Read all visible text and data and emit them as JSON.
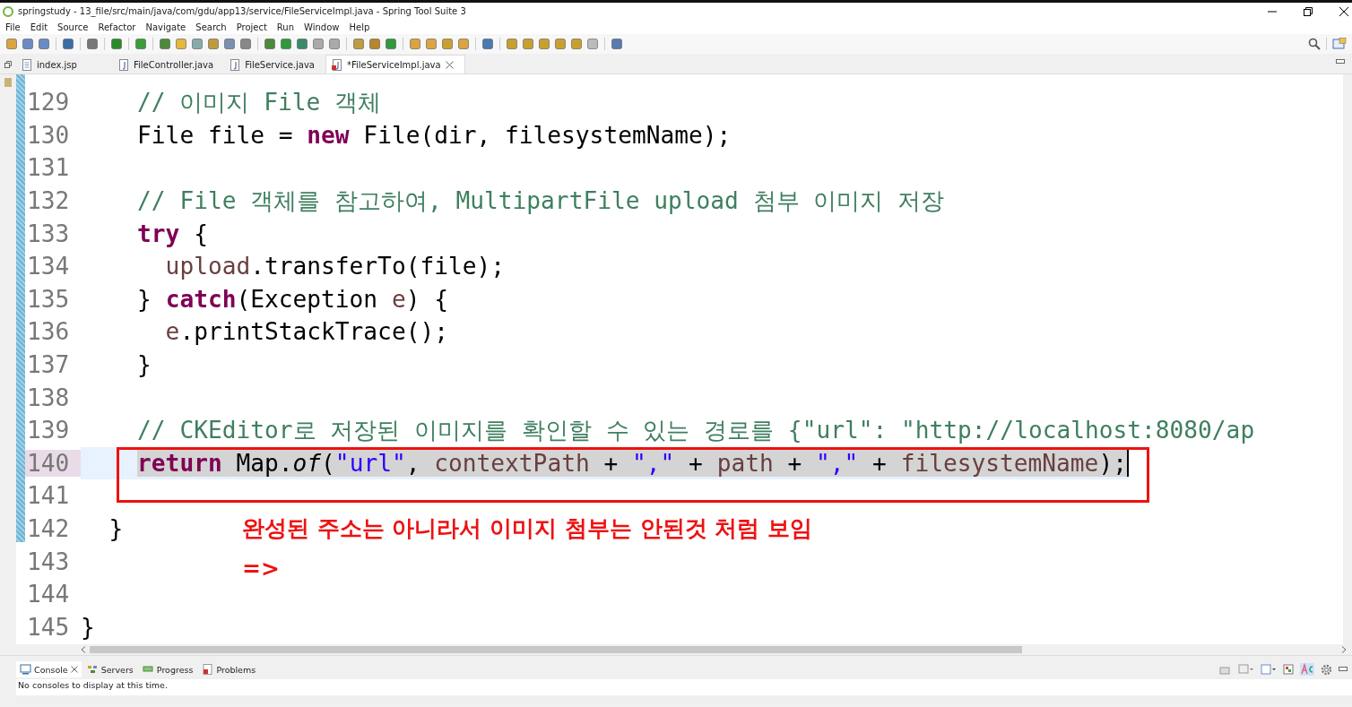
{
  "window": {
    "title": "springstudy - 13_file/src/main/java/com/gdu/app13/service/FileServiceImpl.java - Spring Tool Suite 3"
  },
  "menu": [
    "File",
    "Edit",
    "Source",
    "Refactor",
    "Navigate",
    "Search",
    "Project",
    "Run",
    "Window",
    "Help"
  ],
  "tabs": [
    {
      "label": "index.jsp",
      "selected": false,
      "kind": "jsp"
    },
    {
      "label": "FileController.java",
      "selected": false,
      "kind": "java"
    },
    {
      "label": "FileService.java",
      "selected": false,
      "kind": "java"
    },
    {
      "label": "*FileServiceImpl.java",
      "selected": true,
      "kind": "java"
    }
  ],
  "editor": {
    "lines": [
      {
        "number": "129",
        "current": false,
        "tokens": [
          {
            "text": "    // 이미지 File 객체",
            "kind": "comment"
          }
        ]
      },
      {
        "number": "130",
        "current": false,
        "tokens": [
          {
            "text": "    File file = ",
            "kind": "plain"
          },
          {
            "text": "new",
            "kind": "keyword"
          },
          {
            "text": " File(dir, filesystemName);",
            "kind": "plain"
          }
        ]
      },
      {
        "number": "131",
        "current": false
      },
      {
        "number": "132",
        "current": false,
        "tokens": [
          {
            "text": "    // File 객체를 참고하여, MultipartFile upload 첨부 이미지 저장",
            "kind": "comment"
          }
        ]
      },
      {
        "number": "133",
        "current": false,
        "tokens": [
          {
            "text": "    try",
            "kind": "keyword"
          },
          {
            "text": " {",
            "kind": "plain"
          }
        ]
      },
      {
        "number": "134",
        "current": false,
        "tokens": [
          {
            "text": "      upload",
            "kind": "local"
          },
          {
            "text": ".transferTo(file);",
            "kind": "plain"
          }
        ]
      },
      {
        "number": "135",
        "current": false,
        "tokens": [
          {
            "text": "    } ",
            "kind": "plain"
          },
          {
            "text": "catch",
            "kind": "keyword"
          },
          {
            "text": "(Exception ",
            "kind": "plain"
          },
          {
            "text": "e",
            "kind": "local"
          },
          {
            "text": ") {",
            "kind": "plain"
          }
        ]
      },
      {
        "number": "136",
        "current": false,
        "tokens": [
          {
            "text": "      e",
            "kind": "local"
          },
          {
            "text": ".printStackTrace();",
            "kind": "plain"
          }
        ]
      },
      {
        "number": "137",
        "current": false,
        "tokens": [
          {
            "text": "    }",
            "kind": "plain"
          }
        ]
      },
      {
        "number": "138",
        "current": false
      },
      {
        "number": "139",
        "current": false,
        "tokens": [
          {
            "text": "    // CKEditor로 저장된 이미지를 확인할 수 있는 경로를 {\"url\": \"http://localhost:8080/ap",
            "kind": "comment"
          }
        ]
      },
      {
        "number": "140",
        "current": true,
        "tokens": [
          {
            "text": "    return",
            "kind": "keyword"
          },
          {
            "text": " Map.",
            "kind": "plain"
          },
          {
            "text": "of",
            "kind": "static"
          },
          {
            "text": "(",
            "kind": "plain"
          },
          {
            "text": "\"url\"",
            "kind": "string"
          },
          {
            "text": ", ",
            "kind": "plain"
          },
          {
            "text": "contextPath",
            "kind": "local"
          },
          {
            "text": " + ",
            "kind": "plain"
          },
          {
            "text": "\",\"",
            "kind": "string"
          },
          {
            "text": " + ",
            "kind": "plain"
          },
          {
            "text": "path",
            "kind": "local"
          },
          {
            "text": " + ",
            "kind": "plain"
          },
          {
            "text": "\",\"",
            "kind": "string"
          },
          {
            "text": " + ",
            "kind": "plain"
          },
          {
            "text": "filesystemName",
            "kind": "local"
          },
          {
            "text": ");",
            "kind": "plain"
          }
        ]
      },
      {
        "number": "141",
        "current": false
      },
      {
        "number": "142",
        "current": false,
        "tokens": [
          {
            "text": "  }",
            "kind": "plain"
          }
        ]
      },
      {
        "number": "143",
        "current": false
      },
      {
        "number": "144",
        "current": false
      },
      {
        "number": "145",
        "current": false,
        "tokens": [
          {
            "text": "}",
            "kind": "plain"
          }
        ]
      }
    ]
  },
  "annotation": {
    "lines": [
      "완성된 주소는 아니라서 이미지 첨부는 안된것 처럼 보임",
      "=>"
    ]
  },
  "bottom_panel": {
    "tabs": [
      {
        "label": "Console",
        "selected": true,
        "kind": "console"
      },
      {
        "label": "Servers",
        "selected": false,
        "kind": "servers"
      },
      {
        "label": "Progress",
        "selected": false,
        "kind": "progress"
      },
      {
        "label": "Problems",
        "selected": false,
        "kind": "problems"
      }
    ],
    "message": "No consoles to display at this time."
  }
}
